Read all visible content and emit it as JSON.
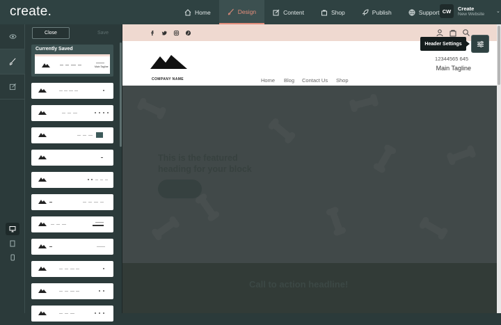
{
  "app": {
    "logo": "create.",
    "nav": [
      {
        "label": "Home",
        "icon": "home-icon"
      },
      {
        "label": "Design",
        "icon": "brush-icon"
      },
      {
        "label": "Content",
        "icon": "edit-icon"
      },
      {
        "label": "Shop",
        "icon": "bag-icon"
      },
      {
        "label": "Publish",
        "icon": "rocket-icon"
      },
      {
        "label": "Support",
        "icon": "globe-icon"
      }
    ],
    "user": {
      "initials": "CW",
      "name": "Create",
      "subtitle": "New Website"
    }
  },
  "panel": {
    "close_label": "Close",
    "save_label": "Save",
    "current_label": "Currently Saved",
    "saved_tagline": "Main Tagline"
  },
  "site": {
    "company": "COMPANY NAME",
    "menu": [
      "Home",
      "Blog",
      "Contact Us",
      "Shop"
    ],
    "phone": "12344565 645",
    "tagline": "Main Tagline",
    "hero_heading": "This is the featured heading for your block",
    "cta": "Call to action headline!"
  },
  "overlay": {
    "tooltip": "Header Settings"
  },
  "colors": {
    "accent": "#e38d7b",
    "sidebar": "#2b3a3a",
    "strip": "#efd9d0"
  }
}
